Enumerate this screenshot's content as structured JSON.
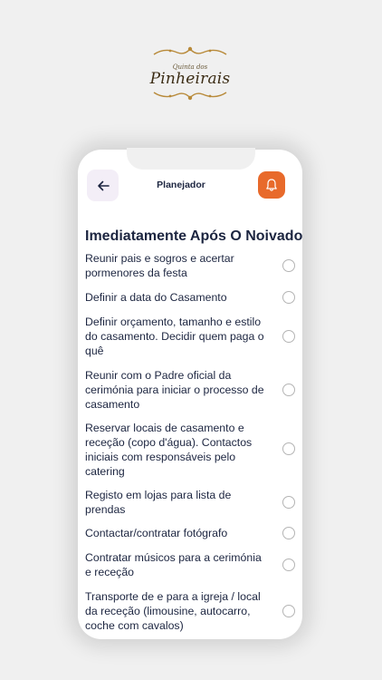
{
  "logo": {
    "line1": "Quinta dos",
    "line2": "Pinheirais"
  },
  "header": {
    "back_icon": "arrow-left-icon",
    "title": "Planejador",
    "bell_icon": "bell-icon"
  },
  "section": {
    "title": "Imediatamente Após O Noivado"
  },
  "tasks": [
    {
      "text": "Reunir pais e sogros e acertar pormenores da festa",
      "checked": false
    },
    {
      "text": "Definir a data do Casamento",
      "checked": false
    },
    {
      "text": "Definir orçamento, tamanho e estilo do casamento. Decidir quem paga o quê",
      "checked": false
    },
    {
      "text": "Reunir com o Padre oficial da cerimónia para iniciar o processo de casamento",
      "checked": false
    },
    {
      "text": "Reservar locais de casamento e receção (copo d'água). Contactos iniciais com responsáveis pelo catering",
      "checked": false
    },
    {
      "text": "Registo em lojas para lista de prendas",
      "checked": false
    },
    {
      "text": "Contactar/contratar fotógrafo",
      "checked": false
    },
    {
      "text": "Contratar músicos para a cerimónia e receção",
      "checked": false
    },
    {
      "text": "Transporte de e para a igreja / local da receção (limousine, autocarro, coche com cavalos)",
      "checked": false
    }
  ],
  "colors": {
    "accent": "#e86a2b",
    "text_dark": "#1c2540",
    "back_button_bg": "#f3eef7"
  }
}
